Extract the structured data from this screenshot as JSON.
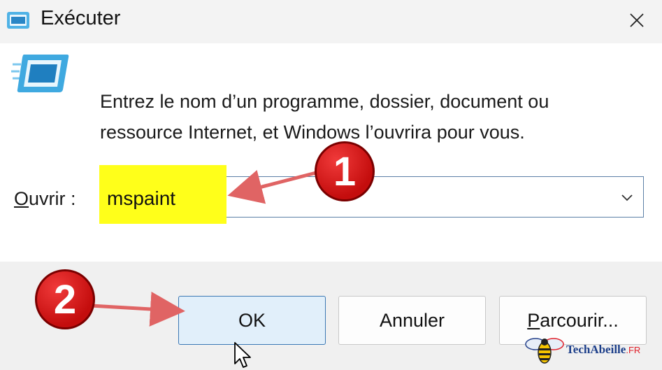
{
  "window": {
    "title": "Exécuter",
    "close_icon": "close-icon"
  },
  "content": {
    "description_line1": "Entrez le nom d’un programme, dossier, document ou",
    "description_line2": "ressource Internet, et Windows l’ouvrira pour vous."
  },
  "open_field": {
    "label_accel": "O",
    "label_rest": "uvrir :",
    "value": "mspaint"
  },
  "buttons": {
    "ok": "OK",
    "cancel": "Annuler",
    "browse_accel": "P",
    "browse_rest": "arcourir..."
  },
  "annotations": {
    "step1": "1",
    "step2": "2"
  },
  "watermark": {
    "name": "TechAbeille",
    "tld": ".FR"
  },
  "colors": {
    "accent": "#3c78b4",
    "highlight": "#ffff1a",
    "badge_red": "#d61818",
    "arrow_red": "#e06060"
  }
}
